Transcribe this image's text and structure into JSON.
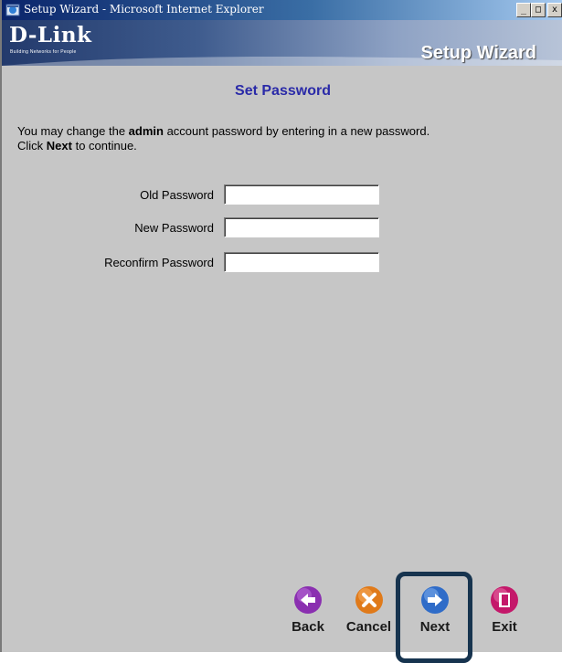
{
  "window": {
    "title": "Setup Wizard - Microsoft Internet Explorer",
    "controls": {
      "minimize": "_",
      "maximize": "□",
      "close": "x"
    }
  },
  "banner": {
    "logo": "D-Link",
    "tagline": "Building Networks for People",
    "title": "Setup Wizard"
  },
  "page": {
    "heading": "Set Password",
    "description_parts": {
      "pre": "You may change the ",
      "bold1": "admin",
      "mid": " account password by entering in a new password.",
      "click": "Click ",
      "bold2": "Next",
      "post": " to continue."
    }
  },
  "form": {
    "old_password": {
      "label": "Old Password",
      "value": ""
    },
    "new_password": {
      "label": "New Password",
      "value": ""
    },
    "reconfirm_password": {
      "label": "Reconfirm Password",
      "value": ""
    }
  },
  "nav": {
    "back": {
      "label": "Back",
      "icon": "back-arrow-icon",
      "color": "#8a2fb0"
    },
    "cancel": {
      "label": "Cancel",
      "icon": "cancel-x-icon",
      "color": "#e07a1a"
    },
    "next": {
      "label": "Next",
      "icon": "next-arrow-icon",
      "color": "#2f6cc8"
    },
    "exit": {
      "label": "Exit",
      "icon": "exit-door-icon",
      "color": "#c4186a"
    }
  },
  "colors": {
    "highlight_border": "#17344f",
    "heading": "#2a2aa8",
    "background": "#c6c6c6"
  }
}
